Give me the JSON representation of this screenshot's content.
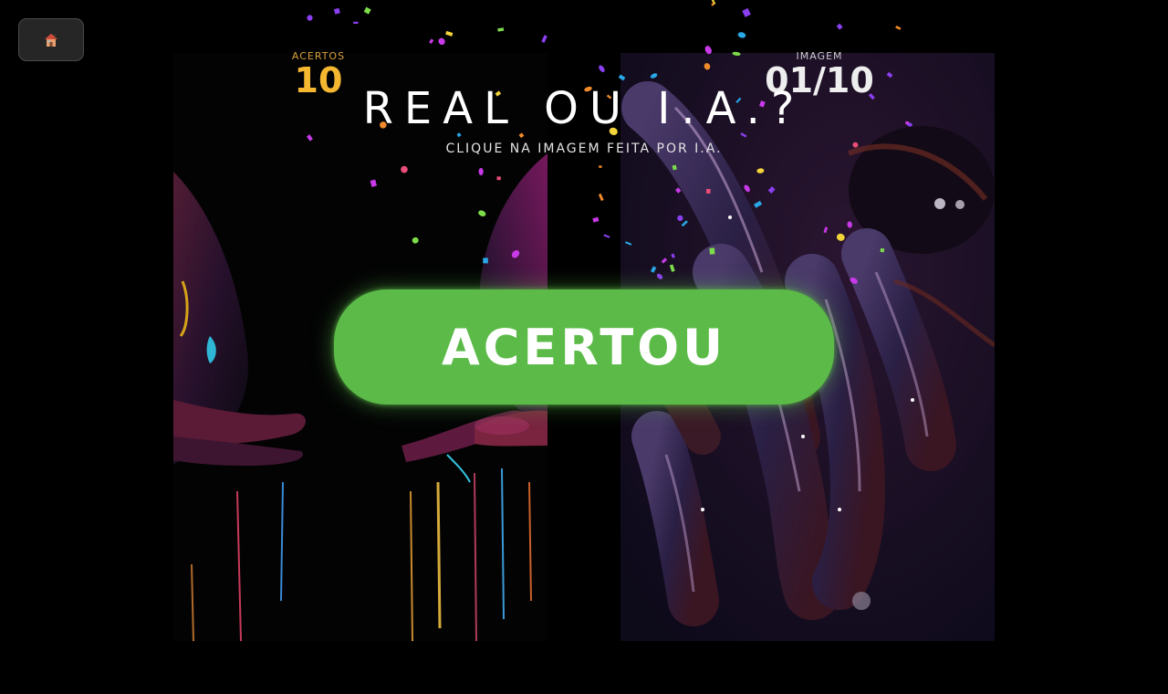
{
  "header": {
    "home_icon": "house-icon",
    "title": "REAL OU I.A.?",
    "subtitle": "CLIQUE NA IMAGEM FEITA POR I.A."
  },
  "stats": {
    "score_label": "ACERTOS",
    "score_value": "10",
    "image_label": "IMAGEM",
    "image_value": "01/10"
  },
  "result": {
    "label": "ACERTOU",
    "color": "#5cbb48"
  },
  "colors": {
    "background": "#000000",
    "score_accent": "#f6b730",
    "confetti": [
      "#e94d78",
      "#8a3ff0",
      "#2aa7e6",
      "#7ddc4a",
      "#f2d33a",
      "#f08a2a",
      "#c83ae8"
    ]
  }
}
